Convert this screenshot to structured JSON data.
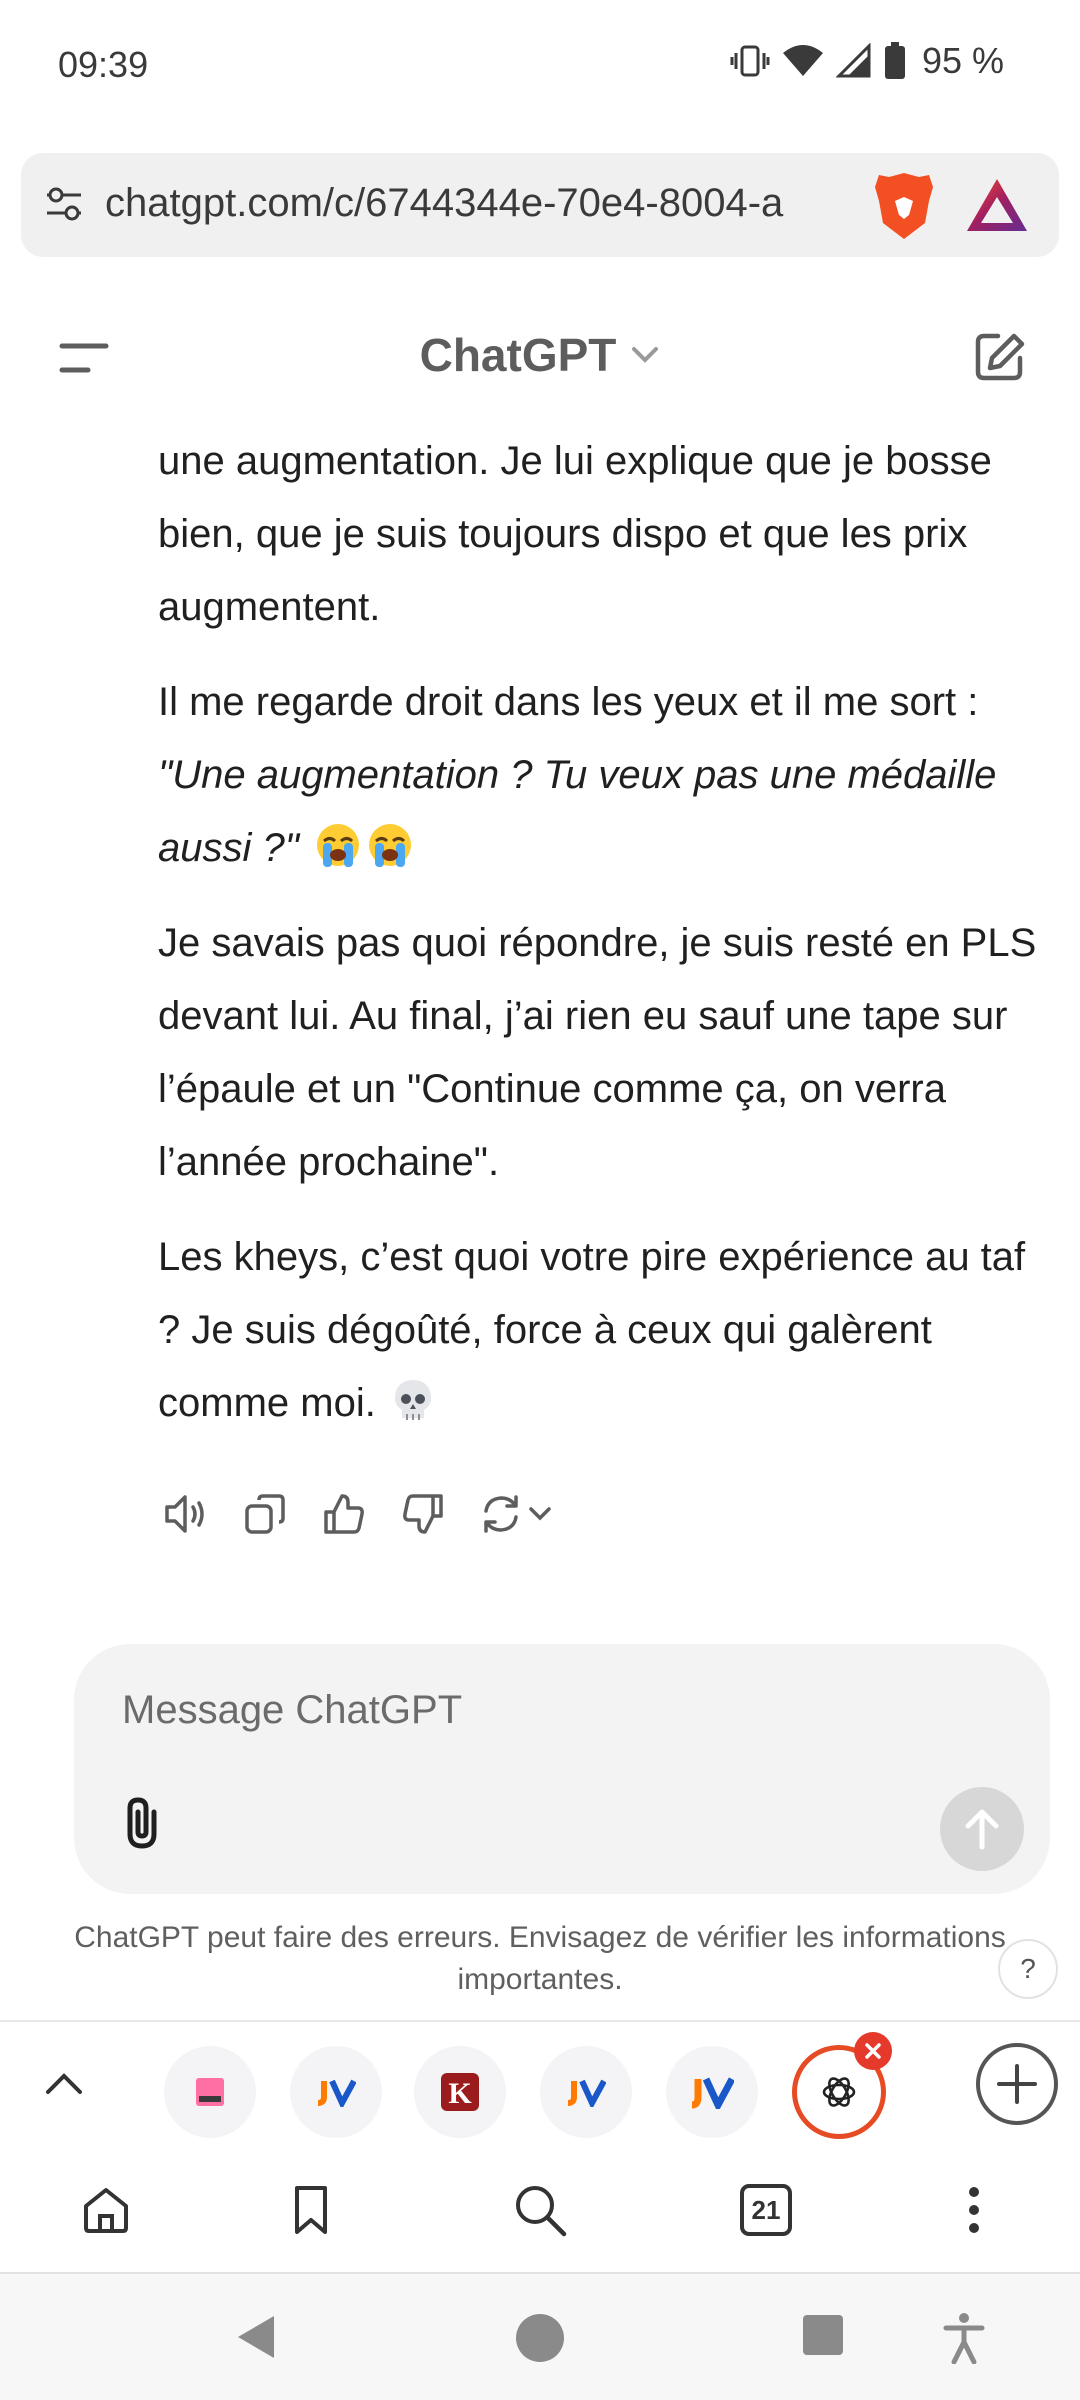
{
  "status_bar": {
    "time": "09:39",
    "battery": "95 %",
    "icons": [
      "vibrate-icon",
      "wifi-icon",
      "signal-icon",
      "battery-icon"
    ]
  },
  "browser": {
    "url": "chatgpt.com/c/6744344e-70e4-8004-a",
    "icons": [
      "site-settings-icon",
      "brave-shields-icon",
      "brave-rewards-icon"
    ]
  },
  "chat_header": {
    "title": "ChatGPT",
    "icons": [
      "menu-icon",
      "chevron-down-icon",
      "new-chat-icon"
    ]
  },
  "message": {
    "p1": "une augmentation. Je lui explique que je bosse bien, que je suis toujours dispo et que les prix augmentent.",
    "p2_lead": "Il me regarde droit dans les yeux et il me sort : ",
    "p2_quote": "\"Une augmentation ? Tu veux pas une médaille aussi ?\"",
    "p2_emoji": "crying-face-emoji x2",
    "p3": "Je savais pas quoi répondre, je suis resté en PLS devant lui. Au final, j’ai rien eu sauf une tape sur l’épaule et un \"Continue comme ça, on verra l’année prochaine\".",
    "p4": "Les kheys, c’est quoi votre pire expérience au taf ? Je suis dégoûté, force à ceux qui galèrent comme moi.",
    "p4_emoji": "skull-emoji"
  },
  "message_actions": [
    "read-aloud-icon",
    "copy-icon",
    "thumbs-up-icon",
    "thumbs-down-icon",
    "regenerate-icon"
  ],
  "composer": {
    "placeholder": "Message ChatGPT"
  },
  "disclaimer": "ChatGPT peut faire des erreurs. Envisagez de vérifier les informations importantes.",
  "help": "?",
  "tabs": {
    "favicons": [
      "pink-site-favicon",
      "jv-favicon",
      "k-favicon",
      "jv-favicon",
      "jv-favicon",
      "openai-favicon"
    ],
    "active_index": 5
  },
  "toolbar": {
    "tab_count": "21",
    "icons": [
      "home-icon",
      "bookmark-icon",
      "search-icon",
      "tabs-icon",
      "more-icon"
    ]
  },
  "colors": {
    "accent": "#e74b24",
    "brave": "#f25022",
    "jv_blue": "#1a58c9"
  }
}
